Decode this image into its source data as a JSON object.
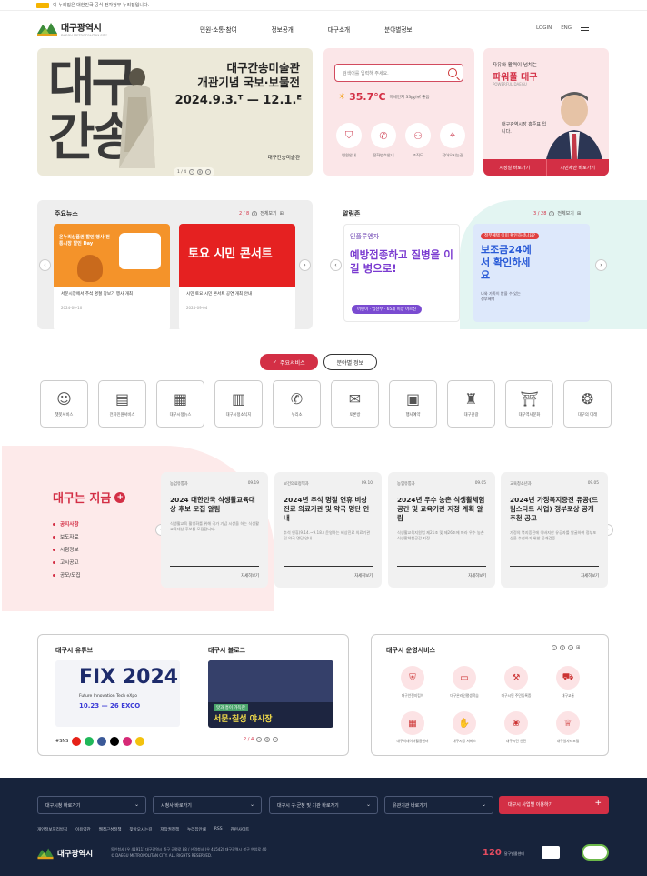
{
  "topbar": {
    "text": "이 누리집은 대한민국 공식 전자정부 누리집입니다."
  },
  "header": {
    "logo_name": "대구광역시",
    "logo_sub": "DAEGU METROPOLITAN CITY",
    "nav": [
      "민원·소통·참여",
      "정보공개",
      "대구소개",
      "분야별정보"
    ],
    "util": [
      "LOGIN",
      "ENG"
    ]
  },
  "hero": {
    "big_text": "대구간송",
    "title_line1": "대구간송미술관",
    "title_line2": "개관기념 국보·보물전",
    "dates": "2024.9.3.ᵀ — 12.1.ᴱ",
    "org": "대구간송미술관",
    "pager": "1 / 4"
  },
  "search": {
    "placeholder": "검색어를 입력해 주세요.",
    "weather_temp": "35.7℃",
    "weather_desc": "미세먼지 33㎍/㎥ 좋음",
    "quick": [
      "민원안내",
      "전화번호안내",
      "조직도",
      "찾아오시는길"
    ]
  },
  "mayor": {
    "line1": "자유와 활력이 넘치는",
    "line2": "파워풀 대구",
    "line3": "POWERFUL DAEGU",
    "name": "대구광역시장  홍준표 입니다.",
    "btn1": "시장실 바로가기",
    "btn2": "시민제안 바로가기"
  },
  "news": {
    "title": "주요뉴스",
    "page": "2 / 8",
    "more": "전체보기",
    "items": [
      {
        "caption": "서문시장에서 추석 명절 장보기 행사 개최",
        "date": "2024-09-10",
        "img_text": "온누리상품권 할인 행사 전통시장 할인 Day"
      },
      {
        "caption": "시민 토요 시민 콘서트 공연 개최 안내",
        "date": "2024-09-04",
        "img_text": "토요 시민 콘서트"
      }
    ]
  },
  "alarm": {
    "title": "알림존",
    "page": "3 / 28",
    "more": "전체보기",
    "items": [
      {
        "line1": "인플루엔자",
        "line2": "예방접종하고 질병을 이길 병으로!",
        "tag": "어린이 · 임산부 · 65세 이상 어르신"
      },
      {
        "line1": "정부혜택 이미 확인하셨나요?",
        "line2": "보조금24에서 확인하세요",
        "tag": "나와 가족이 받을 수 있는 정부혜택"
      }
    ]
  },
  "tabs": {
    "active": "주요서비스",
    "inactive": "분야별 정보"
  },
  "services": [
    {
      "label": "챗봇서비스",
      "icon": "chatbot-icon",
      "glyph": "☺"
    },
    {
      "label": "전자민원서비스",
      "icon": "document-icon",
      "glyph": "▤"
    },
    {
      "label": "대구시정뉴스",
      "icon": "news-icon",
      "glyph": "▦"
    },
    {
      "label": "대구시정소식지",
      "icon": "magazine-icon",
      "glyph": "▥"
    },
    {
      "label": "누리소",
      "icon": "megaphone-icon",
      "glyph": "✆"
    },
    {
      "label": "토론방",
      "icon": "chat-icon",
      "glyph": "✉"
    },
    {
      "label": "행사예약",
      "icon": "calendar-icon",
      "glyph": "▣"
    },
    {
      "label": "대구관광",
      "icon": "tower-icon",
      "glyph": "♜"
    },
    {
      "label": "대구역사문화",
      "icon": "gate-icon",
      "glyph": "⛩"
    },
    {
      "label": "대구의 미래",
      "icon": "bulb-icon",
      "glyph": "❂"
    }
  ],
  "now": {
    "title": "대구는 지금",
    "menu": [
      "공지사항",
      "보도자료",
      "시험정보",
      "고시공고",
      "공모/모집"
    ],
    "cards": [
      {
        "cat": "농업유통과",
        "date": "09.19",
        "title": "2024 대한민국 식생활교육대상 후보 모집 알림",
        "body": "식생활교육 활성화를 위해 국가 기념 시상을 하는 식생활교육대상 후보를 모집합니다.",
        "more": "자세히보기"
      },
      {
        "cat": "보건의료정책과",
        "date": "09.10",
        "title": "2024년 추석 명절 연휴 비상진료 의료기관 및 약국 명단 안내",
        "body": "추석 연휴(9.14.~9.18.) 운영하는 비상진료 의료기관 및 약국 명단 안내",
        "more": "자세히보기"
      },
      {
        "cat": "농업유통과",
        "date": "09.05",
        "title": "2024년 우수 농촌 식생활체험공간 및 교육기관 지정 계획 알림",
        "body": "식생활교육지원법 제21조 및 제26조에 따라 우수 농촌 식생활체험공간 지정",
        "more": "자세히보기"
      },
      {
        "cat": "교육청소년과",
        "date": "09.05",
        "title": "2024년 가정복지증진 유공(드림스타트 사업) 정부포상 공개추천 공고",
        "body": "가정의 복지증진에 이바지한 유공자를 발굴하여 정부포상을 추천하기 위한 공개검증",
        "more": "자세히보기"
      }
    ]
  },
  "media": {
    "youtube_title": "대구시 유튜브",
    "blog_title": "대구시 블로그",
    "fix_title": "FIX 2024",
    "fix_sub": "Future Innovation Tech eXpo",
    "fix_date": "10.23 — 26 EXCO",
    "blog_text": "서문·칠성 야시장",
    "blog_small": "맛과 흥이 가득한",
    "sns_label": "#SNS",
    "pager": "2 / 4"
  },
  "ops": {
    "title": "대구시 운영서비스",
    "items": [
      {
        "label": "대구안전지킴이",
        "icon": "shield-icon",
        "glyph": "⛨"
      },
      {
        "label": "대구온라인평생학습",
        "icon": "monitor-icon",
        "glyph": "▭"
      },
      {
        "label": "대구시민 주민등록증",
        "icon": "id-icon",
        "glyph": "⚒"
      },
      {
        "label": "대구교통",
        "icon": "bus-icon",
        "glyph": "⛟"
      },
      {
        "label": "대구빅데이터활용센터",
        "icon": "grid-icon",
        "glyph": "▦"
      },
      {
        "label": "대구시장 서비스",
        "icon": "handshake-icon",
        "glyph": "✋"
      },
      {
        "label": "대구시민 안전",
        "icon": "leaf-icon",
        "glyph": "❀"
      },
      {
        "label": "대구일자리포털",
        "icon": "podium-icon",
        "glyph": "♕"
      }
    ]
  },
  "footer": {
    "selects": [
      "대구시청 바로가기",
      "시청사 바로가기",
      "대구시 구·군청 및 기관 바로가기",
      "유관기관 바로가기"
    ],
    "button": "대구시 사업별 이용하기",
    "links": [
      "개인정보처리방침",
      "이용약관",
      "웹접근성정책",
      "찾아오시는길",
      "저작권정책",
      "누리집안내",
      "RSS",
      "관련사이트"
    ],
    "logo": "대구광역시",
    "address1": "동인청사 (우 41911) 대구광역시 중구 공평로 88 / 산격청사 (우 41542) 대구광역시 북구 연암로 40",
    "address2": "© DAEGU METROPOLITAN CITY. ALL RIGHTS RESERVED.",
    "hotline": "120",
    "hotline_label": "달구벌콜센터"
  }
}
